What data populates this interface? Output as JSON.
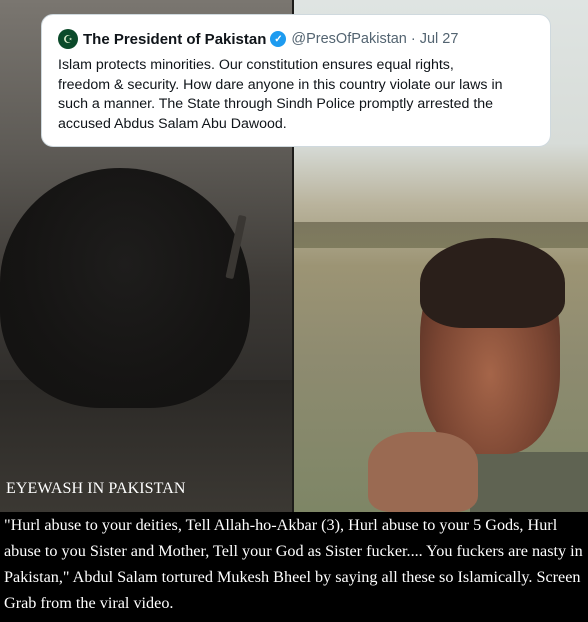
{
  "tweet": {
    "avatar_icon": "pakistan-emblem-icon",
    "author": "The President of Pakistan",
    "handle": "@PresOfPakistan",
    "separator": "·",
    "date": "Jul 27",
    "text": "Islam protects minorities. Our constitution ensures equal rights,\nfreedom & security. How dare anyone in this country violate our laws in\nsuch a manner. The State through Sindh Police promptly arrested the\naccused Abdus Salam Abu Dawood."
  },
  "overlay_title": "EYEWASH IN PAKISTAN",
  "caption": "\"Hurl abuse to your deities, Tell Allah-ho-Akbar (3), Hurl abuse to your 5 Gods, Hurl abuse to you Sister and Mother, Tell your God as Sister fucker.... You fuckers are nasty in  Pakistan,\" Abdul Salam tortured Mukesh Bheel by saying all these so Islamically. Screen Grab from the viral video.",
  "colors": {
    "verified": "#1d9bf0",
    "caption_bg": "#000000",
    "caption_text": "#ffffff"
  }
}
